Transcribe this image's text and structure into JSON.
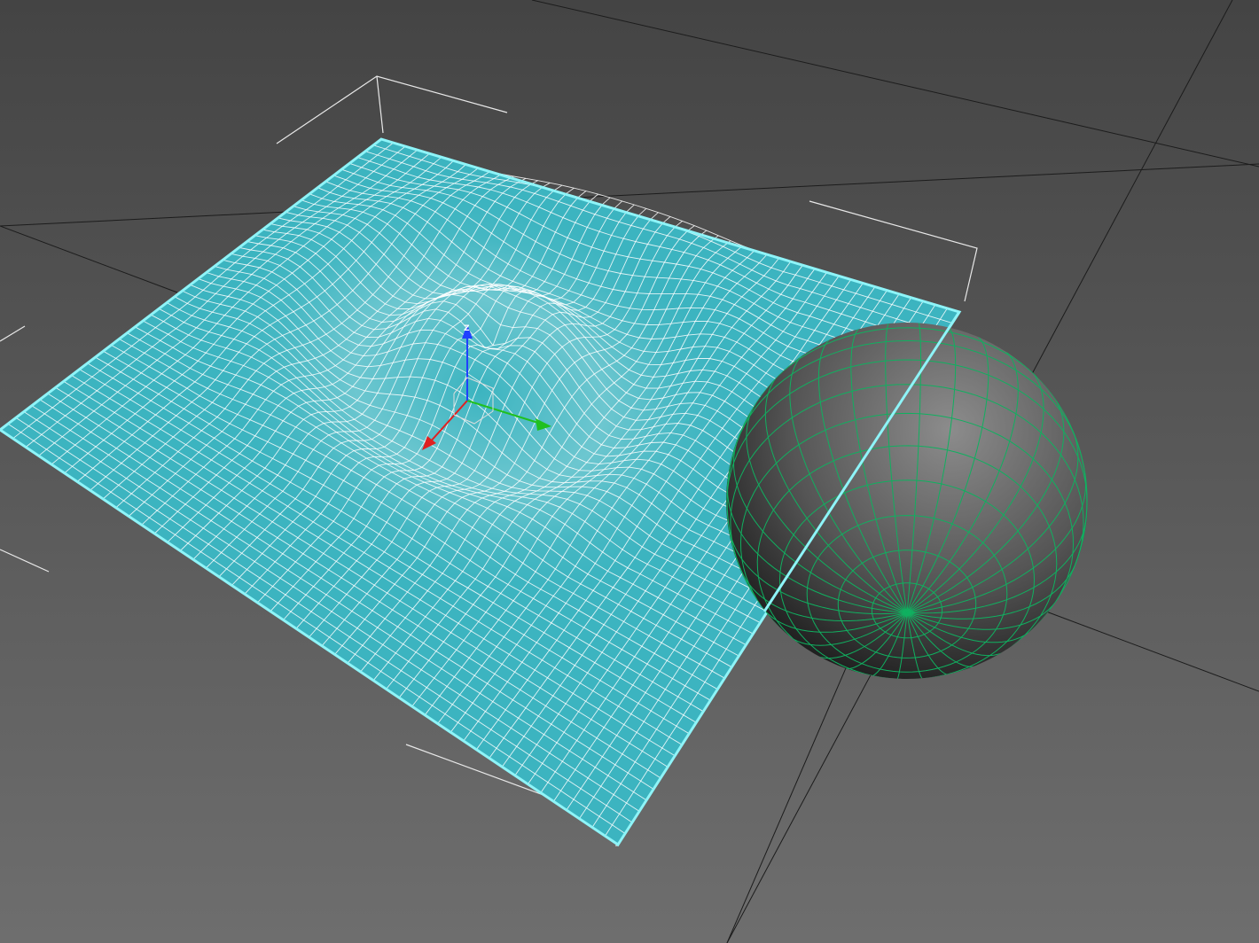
{
  "viewport": {
    "background_top": "#444444",
    "background_bottom": "#6e6e6e",
    "grid_line_color": "#1c1c1c"
  },
  "objects": {
    "plane": {
      "fill": "#3cb4c0",
      "edge_color": "#8ef4f8",
      "wire_color": "#ffffff",
      "selected": true,
      "deformation": "ripple"
    },
    "sphere": {
      "wire_color": "#10b060",
      "shade_light": "#8c8c8c",
      "shade_dark": "#141414"
    }
  },
  "selection_bracket_color": "#e8e8e8",
  "gizmo": {
    "x_color": "#e02020",
    "y_color": "#20c020",
    "z_color": "#2040ff",
    "z_label": "Z"
  }
}
